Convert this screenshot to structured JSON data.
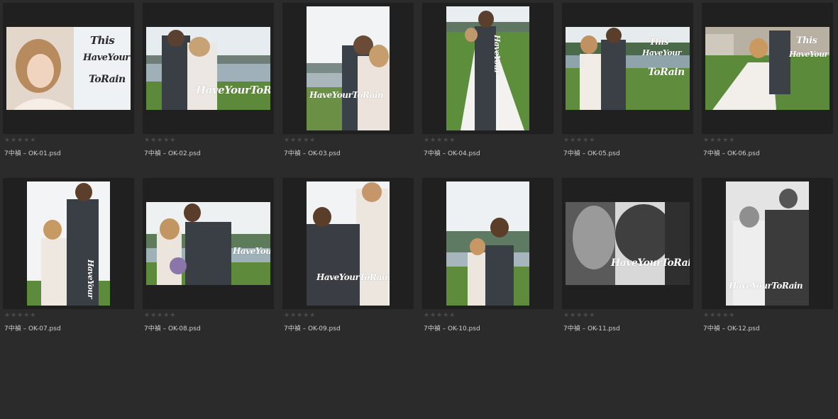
{
  "rating_glyph": "★★★★★",
  "overlay_text": {
    "this": "This",
    "have_your": "HaveYour",
    "to_rain": "ToRain",
    "full": "HaveYourToRain",
    "stacked": "HaveYour"
  },
  "files": [
    {
      "name": "7中禎 – OK-01.psd"
    },
    {
      "name": "7中禎 – OK-02.psd"
    },
    {
      "name": "7中禎 – OK-03.psd"
    },
    {
      "name": "7中禎 – OK-04.psd"
    },
    {
      "name": "7中禎 – OK-05.psd"
    },
    {
      "name": "7中禎 – OK-06.psd"
    },
    {
      "name": "7中禎 – OK-07.psd"
    },
    {
      "name": "7中禎 – OK-08.psd"
    },
    {
      "name": "7中禎 – OK-09.psd"
    },
    {
      "name": "7中禎 – OK-10.psd"
    },
    {
      "name": "7中禎 – OK-11.psd"
    },
    {
      "name": "7中禎 – OK-12.psd"
    }
  ]
}
